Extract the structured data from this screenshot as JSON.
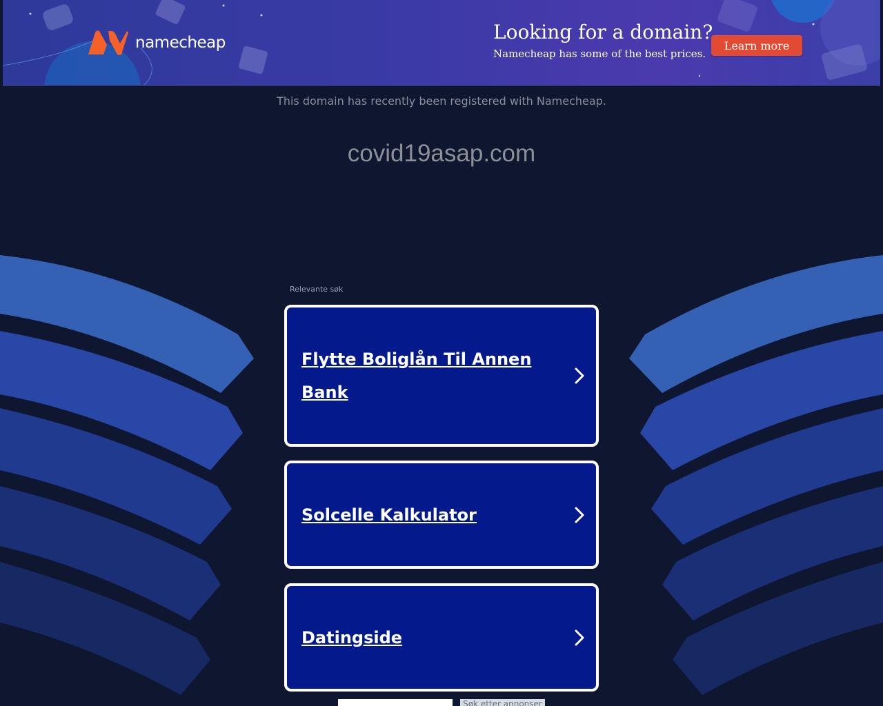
{
  "banner": {
    "logo_text": "namecheap",
    "promo_title": "Looking for a domain?",
    "promo_subtitle": "Namecheap has some of the best prices.",
    "learn_more_label": "Learn more",
    "accent_color": "#e34a33",
    "logo_color": "#f4622a"
  },
  "domain_info": {
    "registered_text": "This domain has recently been registered with Namecheap.",
    "domain_name": "covid19asap.com"
  },
  "related": {
    "label": "Relevante søk",
    "items": [
      {
        "label": "Flytte Boliglån Til Annen Bank",
        "icon": "chevron-right-icon"
      },
      {
        "label": "Solcelle Kalkulator",
        "icon": "chevron-right-icon"
      },
      {
        "label": "Datingside",
        "icon": "chevron-right-icon"
      }
    ]
  },
  "search": {
    "input_value": "",
    "button_label": "Søk etter annonser"
  }
}
